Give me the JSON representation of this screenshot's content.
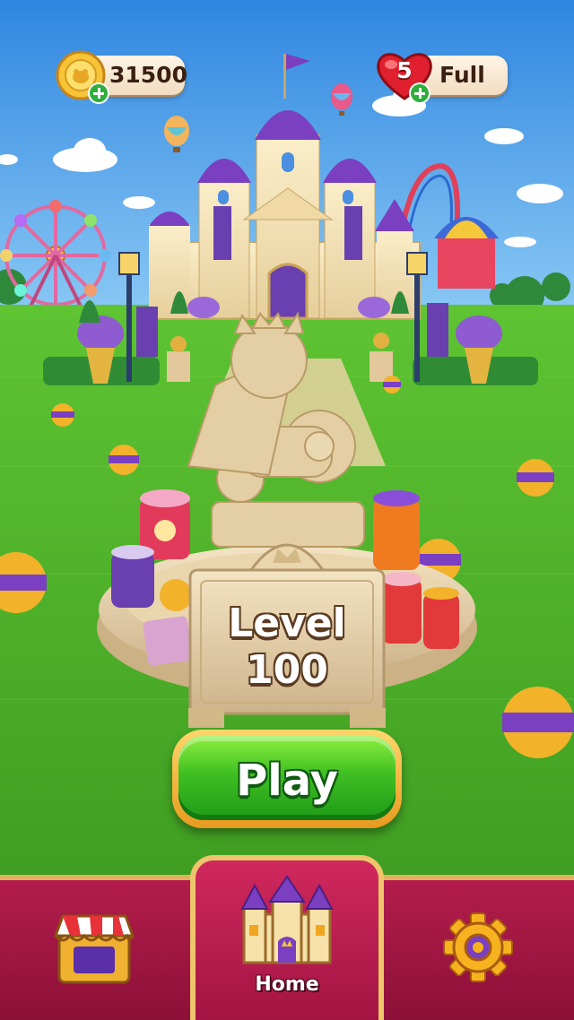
{
  "hud": {
    "coins": "31500",
    "lives": "5",
    "lives_status": "Full"
  },
  "level": {
    "label": "Level",
    "number": "100"
  },
  "play_button": {
    "label": "Play"
  },
  "nav": {
    "home_label": "Home"
  },
  "icons": {
    "coin": "coin-icon",
    "heart": "heart-icon",
    "add": "plus-icon",
    "shop": "shop-icon",
    "castle": "castle-icon",
    "settings": "gear-icon"
  },
  "colors": {
    "sky": "#3d93e6",
    "grass": "#4cb82a",
    "play_green": "#3fbf22",
    "nav_crimson": "#a31443",
    "gold_border": "#e0b25c"
  }
}
